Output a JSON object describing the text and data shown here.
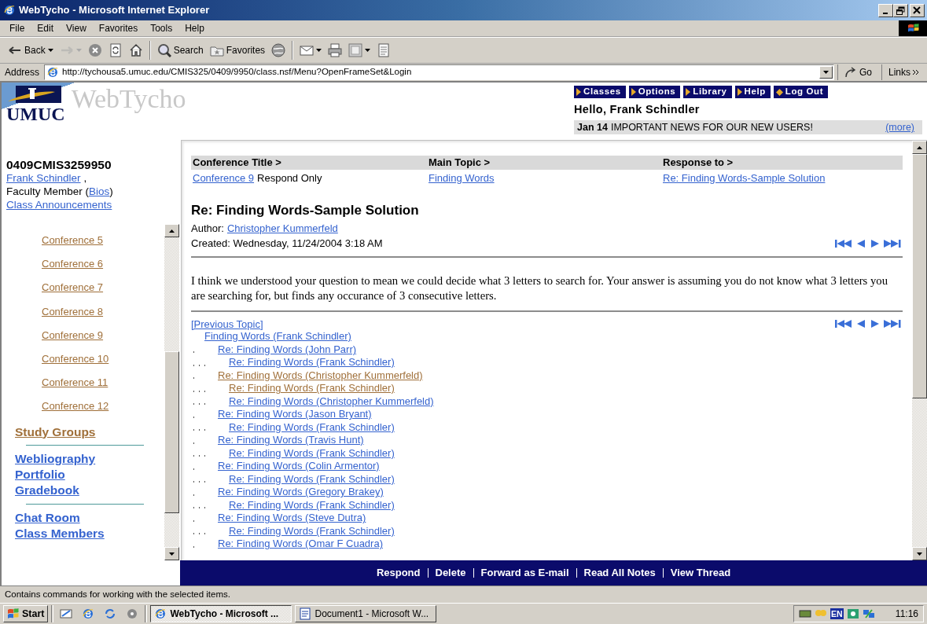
{
  "window": {
    "title": "WebTycho - Microsoft Internet Explorer"
  },
  "menu": [
    {
      "label": "File"
    },
    {
      "label": "Edit"
    },
    {
      "label": "View"
    },
    {
      "label": "Favorites"
    },
    {
      "label": "Tools"
    },
    {
      "label": "Help"
    }
  ],
  "toolbar": [
    {
      "kind": "back",
      "label": "Back",
      "dropdown": true,
      "disabled": false
    },
    {
      "kind": "forward",
      "dropdown": true,
      "disabled": true
    },
    {
      "kind": "stop",
      "disabled": false
    },
    {
      "kind": "refresh",
      "disabled": false
    },
    {
      "kind": "home",
      "disabled": false
    },
    {
      "kind": "separator"
    },
    {
      "kind": "search",
      "label": "Search",
      "disabled": false
    },
    {
      "kind": "favorites",
      "label": "Favorites",
      "disabled": false
    },
    {
      "kind": "media",
      "disabled": false
    },
    {
      "kind": "separator"
    },
    {
      "kind": "mail",
      "dropdown": true,
      "disabled": false
    },
    {
      "kind": "print",
      "disabled": false
    },
    {
      "kind": "edit",
      "dropdown": true,
      "disabled": false
    },
    {
      "kind": "discuss",
      "disabled": false
    }
  ],
  "address": {
    "label": "Address",
    "value": "http://tychousa5.umuc.edu/CMIS325/0409/9950/class.nsf/Menu?OpenFrameSet&Login",
    "go": "Go",
    "links": "Links"
  },
  "header": {
    "logo": "UMUC",
    "brand": "WebTycho",
    "nav": [
      {
        "label": "Classes",
        "kind": "arrow"
      },
      {
        "label": "Options",
        "kind": "arrow"
      },
      {
        "label": "Library",
        "kind": "arrow"
      },
      {
        "label": "Help",
        "kind": "arrow"
      },
      {
        "label": "Log Out",
        "kind": "diamond"
      }
    ],
    "greeting": "Hello, Frank Schindler",
    "news": {
      "date": "Jan 14",
      "text": "IMPORTANT NEWS FOR OUR NEW USERS!",
      "more": "(more)"
    }
  },
  "sidebar": {
    "course": "0409CMIS3259950",
    "faculty": "Frank Schindler",
    "comma": ",",
    "role_prefix": "Faculty Member (",
    "bios": "Bios",
    "role_suffix": ")",
    "announcements": "Class Announcements",
    "conferences": [
      {
        "label": "Conference 5",
        "visited": true
      },
      {
        "label": "Conference 6",
        "visited": true
      },
      {
        "label": "Conference 7",
        "visited": true
      },
      {
        "label": "Conference 8",
        "visited": true
      },
      {
        "label": "Conference 9",
        "visited": true
      },
      {
        "label": "Conference 10",
        "visited": true
      },
      {
        "label": "Conference 11",
        "visited": true
      },
      {
        "label": "Conference 12",
        "visited": true
      }
    ],
    "groups": [
      [
        {
          "label": "Study Groups",
          "visited": true
        }
      ],
      [
        {
          "label": "Webliography",
          "visited": false
        },
        {
          "label": "Portfolio",
          "visited": false
        },
        {
          "label": "Gradebook",
          "visited": false
        }
      ],
      [
        {
          "label": "Chat Room",
          "visited": false
        },
        {
          "label": "Class Members",
          "visited": false
        }
      ]
    ]
  },
  "breadcrumb": [
    {
      "heading": "Conference Title >",
      "link": "Conference 9",
      "note": "Respond Only"
    },
    {
      "heading": "Main Topic >",
      "link": "Finding Words"
    },
    {
      "heading": "Response to >",
      "link": "Re: Finding Words-Sample Solution"
    }
  ],
  "note": {
    "title": "Re: Finding Words-Sample Solution",
    "author_label": "Author:",
    "author": "Christopher Kummerfeld",
    "created": "Created: Wednesday, 11/24/2004 3:18 AM",
    "body": "I think we understood your question to mean we could decide what 3 letters to search for. Your answer is assuming you do not know what 3 letters you are searching for, but finds any occurance of 3 consecutive letters."
  },
  "previous_topic": "[Previous Topic]",
  "thread": [
    {
      "label": "Finding Words (Frank Schindler)",
      "visited": false,
      "children": [
        {
          "label": "Re: Finding Words (John Parr)",
          "visited": false,
          "children": [
            {
              "label": "Re: Finding Words (Frank Schindler)",
              "visited": false
            }
          ]
        },
        {
          "label": "Re: Finding Words (Christopher Kummerfeld)",
          "visited": true,
          "children": [
            {
              "label": "Re: Finding Words (Frank Schindler)",
              "visited": true
            },
            {
              "label": "Re: Finding Words (Christopher Kummerfeld)",
              "visited": false
            }
          ]
        },
        {
          "label": "Re: Finding Words (Jason Bryant)",
          "visited": false,
          "children": [
            {
              "label": "Re: Finding Words (Frank Schindler)",
              "visited": false
            }
          ]
        },
        {
          "label": "Re: Finding Words (Travis Hunt)",
          "visited": false,
          "children": [
            {
              "label": "Re: Finding Words (Frank Schindler)",
              "visited": false
            }
          ]
        },
        {
          "label": "Re: Finding Words (Colin Armentor)",
          "visited": false,
          "children": [
            {
              "label": "Re: Finding Words (Frank Schindler)",
              "visited": false
            }
          ]
        },
        {
          "label": "Re: Finding Words (Gregory Brakey)",
          "visited": false,
          "children": [
            {
              "label": "Re: Finding Words (Frank Schindler)",
              "visited": false
            }
          ]
        },
        {
          "label": "Re: Finding Words (Steve Dutra)",
          "visited": false,
          "children": [
            {
              "label": "Re: Finding Words (Frank Schindler)",
              "visited": false
            }
          ]
        },
        {
          "label": "Re: Finding Words (Omar F Cuadra)",
          "visited": false
        }
      ]
    }
  ],
  "actions": [
    "Respond",
    "Delete",
    "Forward as E-mail",
    "Read All Notes",
    "View Thread"
  ],
  "status_bar": "Contains commands for working with the selected items.",
  "taskbar": {
    "start": "Start",
    "tasks": [
      {
        "label": "WebTycho - Microsoft ...",
        "selected": true
      },
      {
        "label": "Document1 - Microsoft W...",
        "selected": false
      }
    ],
    "language": "EN",
    "clock": "11:16"
  }
}
